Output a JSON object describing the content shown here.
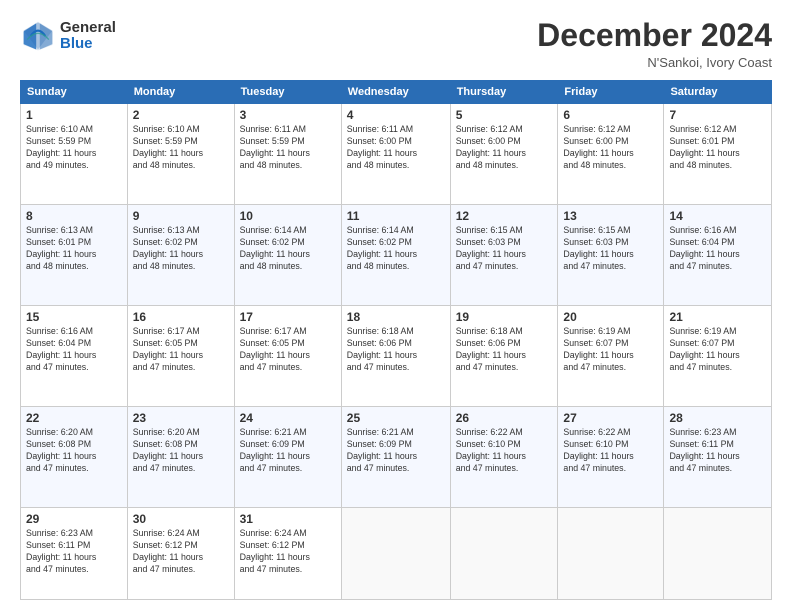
{
  "logo": {
    "general": "General",
    "blue": "Blue"
  },
  "title": {
    "month": "December 2024",
    "location": "N'Sankoi, Ivory Coast"
  },
  "weekdays": [
    "Sunday",
    "Monday",
    "Tuesday",
    "Wednesday",
    "Thursday",
    "Friday",
    "Saturday"
  ],
  "weeks": [
    [
      {
        "day": 1,
        "info": "Sunrise: 6:10 AM\nSunset: 5:59 PM\nDaylight: 11 hours\nand 49 minutes."
      },
      {
        "day": 2,
        "info": "Sunrise: 6:10 AM\nSunset: 5:59 PM\nDaylight: 11 hours\nand 48 minutes."
      },
      {
        "day": 3,
        "info": "Sunrise: 6:11 AM\nSunset: 5:59 PM\nDaylight: 11 hours\nand 48 minutes."
      },
      {
        "day": 4,
        "info": "Sunrise: 6:11 AM\nSunset: 6:00 PM\nDaylight: 11 hours\nand 48 minutes."
      },
      {
        "day": 5,
        "info": "Sunrise: 6:12 AM\nSunset: 6:00 PM\nDaylight: 11 hours\nand 48 minutes."
      },
      {
        "day": 6,
        "info": "Sunrise: 6:12 AM\nSunset: 6:00 PM\nDaylight: 11 hours\nand 48 minutes."
      },
      {
        "day": 7,
        "info": "Sunrise: 6:12 AM\nSunset: 6:01 PM\nDaylight: 11 hours\nand 48 minutes."
      }
    ],
    [
      {
        "day": 8,
        "info": "Sunrise: 6:13 AM\nSunset: 6:01 PM\nDaylight: 11 hours\nand 48 minutes."
      },
      {
        "day": 9,
        "info": "Sunrise: 6:13 AM\nSunset: 6:02 PM\nDaylight: 11 hours\nand 48 minutes."
      },
      {
        "day": 10,
        "info": "Sunrise: 6:14 AM\nSunset: 6:02 PM\nDaylight: 11 hours\nand 48 minutes."
      },
      {
        "day": 11,
        "info": "Sunrise: 6:14 AM\nSunset: 6:02 PM\nDaylight: 11 hours\nand 48 minutes."
      },
      {
        "day": 12,
        "info": "Sunrise: 6:15 AM\nSunset: 6:03 PM\nDaylight: 11 hours\nand 47 minutes."
      },
      {
        "day": 13,
        "info": "Sunrise: 6:15 AM\nSunset: 6:03 PM\nDaylight: 11 hours\nand 47 minutes."
      },
      {
        "day": 14,
        "info": "Sunrise: 6:16 AM\nSunset: 6:04 PM\nDaylight: 11 hours\nand 47 minutes."
      }
    ],
    [
      {
        "day": 15,
        "info": "Sunrise: 6:16 AM\nSunset: 6:04 PM\nDaylight: 11 hours\nand 47 minutes."
      },
      {
        "day": 16,
        "info": "Sunrise: 6:17 AM\nSunset: 6:05 PM\nDaylight: 11 hours\nand 47 minutes."
      },
      {
        "day": 17,
        "info": "Sunrise: 6:17 AM\nSunset: 6:05 PM\nDaylight: 11 hours\nand 47 minutes."
      },
      {
        "day": 18,
        "info": "Sunrise: 6:18 AM\nSunset: 6:06 PM\nDaylight: 11 hours\nand 47 minutes."
      },
      {
        "day": 19,
        "info": "Sunrise: 6:18 AM\nSunset: 6:06 PM\nDaylight: 11 hours\nand 47 minutes."
      },
      {
        "day": 20,
        "info": "Sunrise: 6:19 AM\nSunset: 6:07 PM\nDaylight: 11 hours\nand 47 minutes."
      },
      {
        "day": 21,
        "info": "Sunrise: 6:19 AM\nSunset: 6:07 PM\nDaylight: 11 hours\nand 47 minutes."
      }
    ],
    [
      {
        "day": 22,
        "info": "Sunrise: 6:20 AM\nSunset: 6:08 PM\nDaylight: 11 hours\nand 47 minutes."
      },
      {
        "day": 23,
        "info": "Sunrise: 6:20 AM\nSunset: 6:08 PM\nDaylight: 11 hours\nand 47 minutes."
      },
      {
        "day": 24,
        "info": "Sunrise: 6:21 AM\nSunset: 6:09 PM\nDaylight: 11 hours\nand 47 minutes."
      },
      {
        "day": 25,
        "info": "Sunrise: 6:21 AM\nSunset: 6:09 PM\nDaylight: 11 hours\nand 47 minutes."
      },
      {
        "day": 26,
        "info": "Sunrise: 6:22 AM\nSunset: 6:10 PM\nDaylight: 11 hours\nand 47 minutes."
      },
      {
        "day": 27,
        "info": "Sunrise: 6:22 AM\nSunset: 6:10 PM\nDaylight: 11 hours\nand 47 minutes."
      },
      {
        "day": 28,
        "info": "Sunrise: 6:23 AM\nSunset: 6:11 PM\nDaylight: 11 hours\nand 47 minutes."
      }
    ],
    [
      {
        "day": 29,
        "info": "Sunrise: 6:23 AM\nSunset: 6:11 PM\nDaylight: 11 hours\nand 47 minutes."
      },
      {
        "day": 30,
        "info": "Sunrise: 6:24 AM\nSunset: 6:12 PM\nDaylight: 11 hours\nand 47 minutes."
      },
      {
        "day": 31,
        "info": "Sunrise: 6:24 AM\nSunset: 6:12 PM\nDaylight: 11 hours\nand 47 minutes."
      },
      null,
      null,
      null,
      null
    ]
  ]
}
